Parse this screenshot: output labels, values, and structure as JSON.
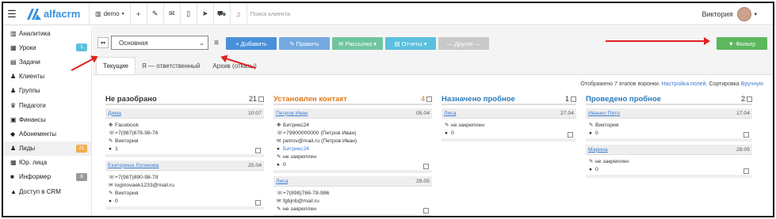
{
  "app": {
    "logo": "alfacrm",
    "branch": "demo",
    "search_placeholder": "Поиск клиента",
    "user": "Виктория"
  },
  "topbar_icons": [
    "plus-icon",
    "wrench-icon",
    "envelope-icon",
    "phone-icon",
    "telegram-icon",
    "cart-icon",
    "bell-icon"
  ],
  "sidebar": {
    "items": [
      {
        "label": "Аналитика",
        "icon": "chart-icon"
      },
      {
        "label": "Уроки",
        "icon": "lessons-icon",
        "badge": "1",
        "badge_color": "#5bc0de"
      },
      {
        "label": "Задачи",
        "icon": "tasks-icon"
      },
      {
        "label": "Клиенты",
        "icon": "user-icon"
      },
      {
        "label": "Группы",
        "icon": "users-icon"
      },
      {
        "label": "Педагоги",
        "icon": "graduation-icon"
      },
      {
        "label": "Финансы",
        "icon": "money-icon"
      },
      {
        "label": "Абонементы",
        "icon": "tag-icon"
      },
      {
        "label": "Лиды",
        "icon": "lead-icon",
        "badge": "21",
        "badge_color": "#f0ad4e"
      },
      {
        "label": "Юр. лица",
        "icon": "building-icon"
      },
      {
        "label": "Информер",
        "icon": "informer-icon",
        "badge": "8",
        "badge_color": "#999999"
      },
      {
        "label": "Доступ в CRM",
        "icon": "lock-icon"
      }
    ]
  },
  "toolbar": {
    "pipeline_value": "Основная",
    "add_label": "+ Добавить",
    "edit_label": "✎ Править",
    "mailing_label": "✉ Рассылка ▾",
    "reports_label": "▤ Отчеты ▾",
    "other_label": "— Другое —",
    "filter_label": "▼ Фильтр",
    "colors": {
      "add": "#4a90d9",
      "edit": "#74a9e0",
      "mailing": "#6fc5a0",
      "reports": "#5bc0de",
      "other": "#c8c8c8",
      "filter": "#5cb85c"
    }
  },
  "tabs": [
    "Текущие",
    "Я — ответственный",
    "Архив (отказы)"
  ],
  "board_info": {
    "text": "Отображено 7 этапов воронки.",
    "settings_link": "Настройка полей",
    "sort_text": ". Сортировка",
    "sort_link": "Вручную"
  },
  "columns": [
    {
      "title": "Не разобрано",
      "count": "21",
      "color": "#333333",
      "cards": [
        {
          "name": "Дима",
          "date": "10:07",
          "lines": [
            {
              "icon": "✥",
              "text": "Facebook"
            },
            {
              "icon": "☏",
              "text": "+7(987)678-98-76"
            },
            {
              "icon": "✎",
              "text": "Виктория"
            },
            {
              "icon": "●",
              "text": "1"
            }
          ]
        },
        {
          "name": "Екатерина Логинова",
          "date": "25.04",
          "lines": [
            {
              "icon": "☏",
              "text": "+7(987)890-98-78"
            },
            {
              "icon": "✉",
              "text": "loginovaek1233@mail.ru"
            },
            {
              "icon": "✎",
              "text": "Виктория"
            },
            {
              "icon": "●",
              "text": "0"
            }
          ]
        }
      ]
    },
    {
      "title": "Установлен контакт",
      "count": "4",
      "color": "#e07a1a",
      "cards": [
        {
          "name": "Петров Иван",
          "date": "05.04",
          "lines": [
            {
              "icon": "✥",
              "text": "Битрикс24"
            },
            {
              "icon": "☏",
              "text": "+79900000000 (Петров Иван)"
            },
            {
              "icon": "✉",
              "text": "petrov@mail.ru (Петров Иван)"
            },
            {
              "icon": "●",
              "text": "Битрикс24",
              "blue": true
            },
            {
              "icon": "✎",
              "text": "не закреплен"
            },
            {
              "icon": "●",
              "text": "0"
            }
          ]
        },
        {
          "name": "Лиса",
          "date": "29.05",
          "lines": [
            {
              "icon": "☏",
              "text": "+7(898)766-78-986"
            },
            {
              "icon": "✉",
              "text": "fgbjnb@mail.ru"
            },
            {
              "icon": "✎",
              "text": "не закреплен"
            }
          ]
        }
      ]
    },
    {
      "title": "Назначено пробное",
      "count": "1",
      "color": "#2a7ab8",
      "cards": [
        {
          "name": "Лиса",
          "date": "27.04",
          "lines": [
            {
              "icon": "✎",
              "text": "не закреплен"
            },
            {
              "icon": "●",
              "text": "0"
            }
          ]
        }
      ]
    },
    {
      "title": "Проведено пробное",
      "count": "2",
      "color": "#2a7ab8",
      "cards": [
        {
          "name": "Иванко Пето",
          "date": "17.04",
          "lines": [
            {
              "icon": "✎",
              "text": "Виктория"
            },
            {
              "icon": "●",
              "text": "0"
            }
          ]
        },
        {
          "name": "Марина",
          "date": "29.05",
          "lines": [
            {
              "icon": "✎",
              "text": "не закреплен"
            },
            {
              "icon": "●",
              "text": "0"
            }
          ]
        }
      ]
    }
  ]
}
